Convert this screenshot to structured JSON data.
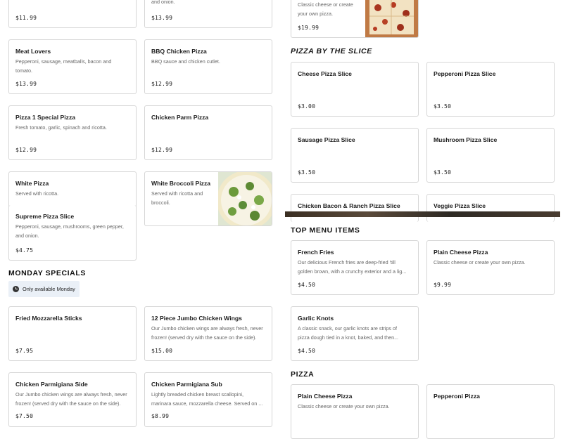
{
  "left": {
    "row0": [
      {
        "price": "$11.99"
      },
      {
        "desc": "and onion.",
        "price": "$13.99"
      }
    ],
    "items": [
      {
        "name": "Meat Lovers",
        "desc": "Pepperoni, sausage, meatballs, bacon and\ntomato.",
        "price": "$13.99"
      },
      {
        "name": "BBQ Chicken Pizza",
        "desc": "BBQ sauce and chicken cutlet.",
        "price": "$12.99"
      },
      {
        "name": "Pizza 1 Special Pizza",
        "desc": "Fresh tomato, garlic, spinach and ricotta.",
        "price": "$12.99"
      },
      {
        "name": "Chicken Parm Pizza",
        "desc": "",
        "price": "$12.99"
      },
      {
        "name": "White Pizza",
        "desc": "Served with ricotta.",
        "price": ""
      },
      {
        "name": "White Broccoli Pizza",
        "desc": "Served with ricotta and\nbroccoli.",
        "price": ""
      },
      {
        "name": "Supreme Pizza Slice",
        "desc": "Pepperoni, sausage, mushrooms, green pepper,\nand onion.",
        "price": "$4.75"
      }
    ],
    "monday": {
      "title": "MONDAY SPECIALS",
      "badge": "Only available Monday",
      "items": [
        {
          "name": "Fried Mozzarella Sticks",
          "desc": "",
          "price": "$7.95"
        },
        {
          "name": "12 Piece Jumbo Chicken Wings",
          "desc": "Our Jumbo chicken wings are always fresh, never\nfrozen! (served dry with the sauce on the side).",
          "price": "$15.00"
        },
        {
          "name": "Chicken Parmigiana Side",
          "desc": "Our Jumbo chicken wings are always fresh, never\nfrozen! (served dry with the sauce on the side).",
          "price": "$7.50"
        },
        {
          "name": "Chicken Parmigiana Sub",
          "desc": "Lightly breaded chicken breast scallopini,\nmarinara sauce, mozzarella cheese. Served on ...",
          "price": "$8.99"
        }
      ]
    }
  },
  "right": {
    "top_card": {
      "desc": "Classic cheese or create\nyour own pizza.",
      "price": "$19.99"
    },
    "slice": {
      "title": "PIZZA BY THE SLICE",
      "items": [
        {
          "name": "Cheese Pizza Slice",
          "price": "$3.00"
        },
        {
          "name": "Pepperoni Pizza Slice",
          "price": "$3.50"
        },
        {
          "name": "Sausage Pizza Slice",
          "price": "$3.50"
        },
        {
          "name": "Mushroom Pizza Slice",
          "price": "$3.50"
        },
        {
          "name": "Chicken Bacon & Ranch Pizza Slice",
          "price": ""
        },
        {
          "name": "Veggie Pizza Slice",
          "price": ""
        }
      ]
    },
    "top_items": {
      "title": "TOP MENU ITEMS",
      "items": [
        {
          "name": "French Fries",
          "desc": "Our delicious French fries are deep-fried 'till\ngolden brown, with a crunchy exterior and a lig...",
          "price": "$4.50"
        },
        {
          "name": "Plain Cheese Pizza",
          "desc": "Classic cheese or create your own pizza.",
          "price": "$9.99"
        },
        {
          "name": "Garlic Knots",
          "desc": "A classic snack, our garlic knots are strips of\npizza dough tied in a knot, baked, and then...",
          "price": "$4.50"
        }
      ]
    },
    "pizza": {
      "title": "PIZZA",
      "items": [
        {
          "name": "Plain Cheese Pizza",
          "desc": "Classic cheese or create your own pizza."
        },
        {
          "name": "Pepperoni Pizza",
          "desc": ""
        }
      ]
    }
  },
  "colors": {
    "badge_bg": "#eaf0f7",
    "border": "#d6d6d6",
    "price": "#1c1c1c"
  }
}
